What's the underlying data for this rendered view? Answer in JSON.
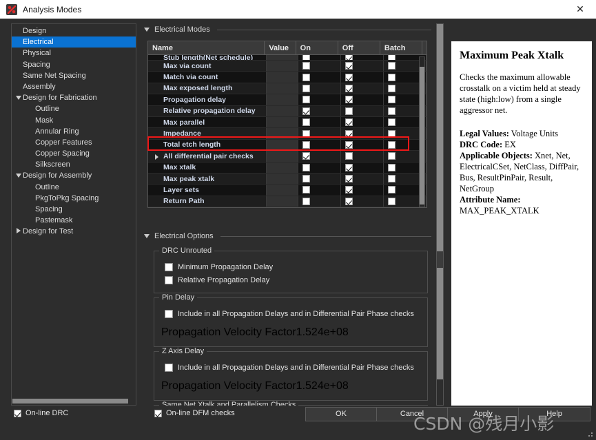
{
  "window": {
    "title": "Analysis Modes",
    "icon": "app-icon",
    "close_label": "✕"
  },
  "sidebar": {
    "items": [
      {
        "label": "Design",
        "level": 0,
        "twisty": "none",
        "selected": false
      },
      {
        "label": "Electrical",
        "level": 0,
        "twisty": "none",
        "selected": true
      },
      {
        "label": "Physical",
        "level": 0,
        "twisty": "none",
        "selected": false
      },
      {
        "label": "Spacing",
        "level": 0,
        "twisty": "none",
        "selected": false
      },
      {
        "label": "Same Net Spacing",
        "level": 0,
        "twisty": "none",
        "selected": false
      },
      {
        "label": "Assembly",
        "level": 0,
        "twisty": "none",
        "selected": false
      },
      {
        "label": "Design for Fabrication",
        "level": 0,
        "twisty": "open",
        "selected": false
      },
      {
        "label": "Outline",
        "level": 1,
        "twisty": "none",
        "selected": false
      },
      {
        "label": "Mask",
        "level": 1,
        "twisty": "none",
        "selected": false
      },
      {
        "label": "Annular Ring",
        "level": 1,
        "twisty": "none",
        "selected": false
      },
      {
        "label": "Copper Features",
        "level": 1,
        "twisty": "none",
        "selected": false
      },
      {
        "label": "Copper Spacing",
        "level": 1,
        "twisty": "none",
        "selected": false
      },
      {
        "label": "Silkscreen",
        "level": 1,
        "twisty": "none",
        "selected": false
      },
      {
        "label": "Design for Assembly",
        "level": 0,
        "twisty": "open",
        "selected": false
      },
      {
        "label": "Outline",
        "level": 1,
        "twisty": "none",
        "selected": false
      },
      {
        "label": "PkgToPkg Spacing",
        "level": 1,
        "twisty": "none",
        "selected": false
      },
      {
        "label": "Spacing",
        "level": 1,
        "twisty": "none",
        "selected": false
      },
      {
        "label": "Pastemask",
        "level": 1,
        "twisty": "none",
        "selected": false
      },
      {
        "label": "Design for Test",
        "level": 0,
        "twisty": "closed",
        "selected": false
      }
    ]
  },
  "modes_section": {
    "title": "Electrical Modes",
    "columns": [
      "Name",
      "Value",
      "On",
      "Off",
      "Batch"
    ],
    "rows": [
      {
        "name": "Stub length(Net schedule)",
        "clipped": true,
        "expandable": false,
        "value": "",
        "on": false,
        "off": true,
        "batch": false,
        "highlight": false
      },
      {
        "name": "Max via count",
        "clipped": false,
        "expandable": false,
        "value": "",
        "on": false,
        "off": true,
        "batch": false,
        "highlight": false
      },
      {
        "name": "Match via count",
        "clipped": false,
        "expandable": false,
        "value": "",
        "on": false,
        "off": true,
        "batch": false,
        "highlight": false
      },
      {
        "name": "Max exposed length",
        "clipped": false,
        "expandable": false,
        "value": "",
        "on": false,
        "off": true,
        "batch": false,
        "highlight": false
      },
      {
        "name": "Propagation delay",
        "clipped": false,
        "expandable": false,
        "value": "",
        "on": false,
        "off": true,
        "batch": false,
        "highlight": false
      },
      {
        "name": "Relative propagation delay",
        "clipped": false,
        "expandable": false,
        "value": "",
        "on": true,
        "off": false,
        "batch": false,
        "highlight": true
      },
      {
        "name": "Max parallel",
        "clipped": false,
        "expandable": false,
        "value": "",
        "on": false,
        "off": true,
        "batch": false,
        "highlight": false
      },
      {
        "name": "Impedance",
        "clipped": false,
        "expandable": false,
        "value": "",
        "on": false,
        "off": true,
        "batch": false,
        "highlight": false
      },
      {
        "name": "Total etch length",
        "clipped": false,
        "expandable": false,
        "value": "",
        "on": false,
        "off": true,
        "batch": false,
        "highlight": false
      },
      {
        "name": "All differential pair checks",
        "clipped": false,
        "expandable": true,
        "value": "",
        "on": true,
        "off": false,
        "batch": false,
        "highlight": false
      },
      {
        "name": "Max xtalk",
        "clipped": false,
        "expandable": false,
        "value": "",
        "on": false,
        "off": true,
        "batch": false,
        "highlight": false
      },
      {
        "name": "Max peak xtalk",
        "clipped": false,
        "expandable": false,
        "value": "",
        "on": false,
        "off": true,
        "batch": false,
        "highlight": false
      },
      {
        "name": "Layer sets",
        "clipped": false,
        "expandable": false,
        "value": "",
        "on": false,
        "off": true,
        "batch": false,
        "highlight": false
      },
      {
        "name": "Return Path",
        "clipped": false,
        "expandable": false,
        "value": "",
        "on": false,
        "off": true,
        "batch": false,
        "highlight": false
      }
    ]
  },
  "options_section": {
    "title": "Electrical Options",
    "groups": [
      {
        "legend": "DRC Unrouted",
        "checkboxes": [
          {
            "label": "Minimum Propagation Delay",
            "checked": false
          },
          {
            "label": "Relative Propagation Delay",
            "checked": false
          }
        ],
        "field": null
      },
      {
        "legend": "Pin Delay",
        "checkboxes": [
          {
            "label": "Include in all Propagation Delays and in Differential Pair Phase checks",
            "checked": false
          }
        ],
        "field": {
          "label": "Propagation Velocity Factor",
          "value": "1.524e+08"
        }
      },
      {
        "legend": "Z Axis Delay",
        "checkboxes": [
          {
            "label": "Include in all Propagation Delays and in Differential Pair Phase checks",
            "checked": false
          }
        ],
        "field": {
          "label": "Propagation Velocity Factor",
          "value": "1.524e+08"
        }
      },
      {
        "legend": "Same Net Xtalk and Parallelism Checks",
        "checkboxes": [],
        "field": null
      }
    ]
  },
  "help": {
    "heading": "Maximum Peak Xtalk",
    "description": "Checks the maximum allowable crosstalk on a victim held at steady state (high:low) from a single aggressor net.",
    "legal_values_label": "Legal Values:",
    "legal_values": "Voltage Units",
    "drc_code_label": "DRC Code:",
    "drc_code": "EX",
    "applicable_objects_label": "Applicable Objects:",
    "applicable_objects": "Xnet, Net, ElectricalCSet, NetClass, DiffPair, Bus, ResultPinPair, Result, NetGroup",
    "attribute_name_label": "Attribute Name:",
    "attribute_name": "MAX_PEAK_XTALK"
  },
  "footer": {
    "online_drc": {
      "label": "On-line DRC",
      "checked": true
    },
    "online_dfm": {
      "label": "On-line DFM checks",
      "checked": true
    },
    "buttons": [
      "OK",
      "Cancel",
      "Apply",
      "Help"
    ]
  },
  "watermark": {
    "text": "CSDN @残月小影"
  },
  "colors": {
    "accent": "#0a72d2",
    "highlight": "#f01818",
    "dialog_bg": "#2d2d2d",
    "titlebar_bg": "#ffffff",
    "help_bg": "#ffffff"
  }
}
